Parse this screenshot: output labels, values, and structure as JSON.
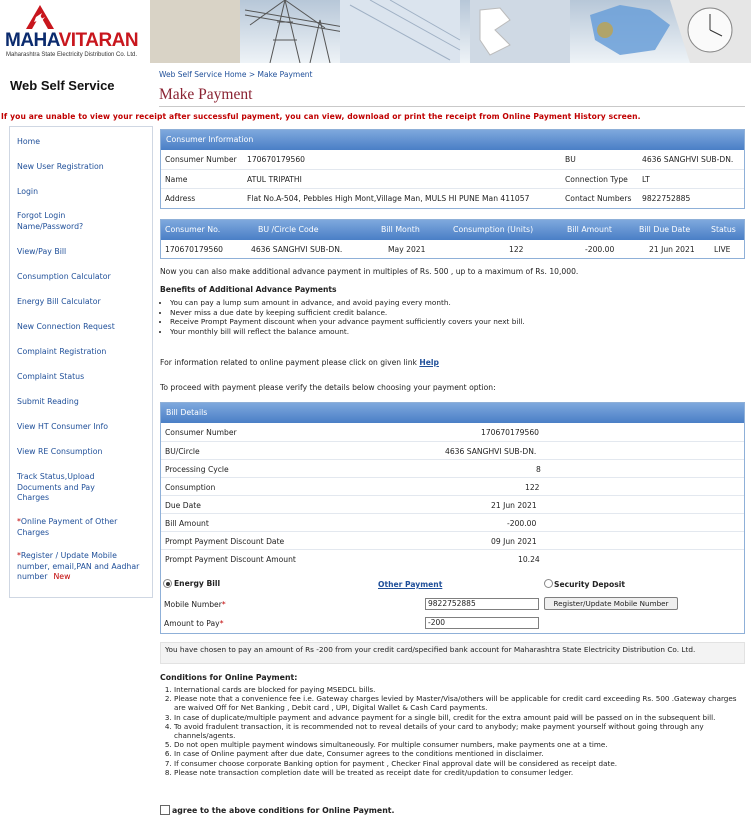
{
  "brand": {
    "logo_main_1": "MAHA",
    "logo_main_2": "VITARAN",
    "logo_sub": "Maharashtra State Electricity Distribution Co. Ltd."
  },
  "header": {
    "site_title": "Web Self Service",
    "breadcrumb": "Web Self Service Home > Make Payment",
    "page_title": "Make Payment"
  },
  "warning": "If you are unable to view your receipt after successful payment, you can view, download or print the receipt from Online Payment History screen.",
  "sidebar": {
    "items": [
      {
        "label": "Home"
      },
      {
        "label": "New User Registration"
      },
      {
        "label": "Login"
      },
      {
        "label": "Forgot Login Name/Password?"
      },
      {
        "label": "View/Pay Bill"
      },
      {
        "label": "Consumption Calculator"
      },
      {
        "label": "Energy Bill Calculator"
      },
      {
        "label": "New Connection Request"
      },
      {
        "label": "Complaint Registration"
      },
      {
        "label": "Complaint Status"
      },
      {
        "label": "Submit Reading"
      },
      {
        "label": "View HT Consumer Info"
      },
      {
        "label": "View RE Consumption"
      },
      {
        "label": "Track Status,Upload Documents and Pay Charges"
      },
      {
        "label": "Online Payment of Other Charges",
        "star": "*"
      },
      {
        "label": "Register / Update Mobile number, email,PAN and Aadhar number",
        "star": "*",
        "badge": "New"
      }
    ]
  },
  "consumer_info": {
    "heading": "Consumer Information",
    "consumer_number_label": "Consumer Number",
    "consumer_number": "170670179560",
    "bu_label": "BU",
    "bu": "4636 SANGHVI SUB-DN.",
    "name_label": "Name",
    "name": "ATUL TRIPATHI",
    "conn_type_label": "Connection Type",
    "conn_type": "LT",
    "address_label": "Address",
    "address": "Flat No.A-504, Pebbles High Mont,Village Man, MULS HI PUNE Man 411057",
    "contact_label": "Contact Numbers",
    "contact": "9822752885"
  },
  "bill_table": {
    "headers": [
      "Consumer No.",
      "BU /Circle Code",
      "Bill Month",
      "Consumption (Units)",
      "Bill Amount",
      "Bill Due Date",
      "Status"
    ],
    "row": [
      "170670179560",
      "4636 SANGHVI SUB-DN.",
      "May 2021",
      "122",
      "-200.00",
      "21 Jun 2021",
      "LIVE"
    ]
  },
  "advance_note": "Now you can also make additional advance payment in multiples of Rs. 500 , up to a maximum of Rs. 10,000.",
  "benefits": {
    "title": "Benefits of Additional Advance Payments",
    "items": [
      "You can pay a lump sum amount in advance, and avoid paying every month.",
      "Never miss a due date by keeping sufficient credit balance.",
      "Receive Prompt Payment discount when your advance payment sufficiently covers your next bill.",
      "Your monthly bill will reflect the balance amount."
    ]
  },
  "help": {
    "text": "For information related to online payment please click on given link",
    "link": "Help"
  },
  "proceed_text": "To proceed with payment please verify the details below choosing your payment option:",
  "bill_details": {
    "heading": "Bill Details",
    "rows": [
      {
        "label": "Consumer Number",
        "value": "170670179560"
      },
      {
        "label": "BU/Circle",
        "value": "4636 SANGHVI SUB-DN."
      },
      {
        "label": "Processing Cycle",
        "value": "8"
      },
      {
        "label": "Consumption",
        "value": "122"
      },
      {
        "label": "Due Date",
        "value": "21 Jun 2021"
      },
      {
        "label": "Bill Amount",
        "value": "-200.00"
      },
      {
        "label": "Prompt Payment Discount Date",
        "value": "09 Jun 2021"
      },
      {
        "label": "Prompt Payment Discount Amount",
        "value": "10.24"
      }
    ],
    "option_energy": "Energy Bill",
    "option_other": "Other Payment",
    "option_security": "Security Deposit",
    "mobile_label": "Mobile Number",
    "mobile_value": "9822752885",
    "update_button": "Register/Update Mobile Number",
    "amount_label": "Amount to Pay",
    "amount_value": "-200",
    "required_mark": "*"
  },
  "notice": "You have chosen to pay an amount of Rs -200 from your credit card/specified bank account for Maharashtra State Electricity Distribution Co. Ltd.",
  "conditions": {
    "title": "Conditions for Online Payment:",
    "items": [
      "International cards are blocked for paying MSEDCL bills.",
      "Please note that a convenience fee i.e. Gateway charges levied by Master/Visa/others will be applicable for credit card exceeding Rs. 500 .Gateway charges are waived Off for Net Banking , Debit card , UPI, Digital Wallet & Cash Card payments.",
      "In case of duplicate/multiple payment and advance payment for a single bill, credit for the extra amount paid will be passed on in the subsequent bill.",
      "To avoid fradulent transaction, it is recommended not to reveal details of your card to anybody; make payment yourself without going through any channels/agents.",
      "Do not open multiple payment windows simultaneously. For multiple consumer numbers, make payments one at a time.",
      "In case of Online payment after due date, Consumer agrees to the conditions mentioned in disclaimer.",
      "If consumer choose corporate Banking option for payment , Checker Final approval date will be considered as receipt date.",
      "Please note transaction completion date will be treated as receipt date for credit/updation to consumer ledger."
    ],
    "agree": "agree to the above conditions for Online Payment."
  }
}
